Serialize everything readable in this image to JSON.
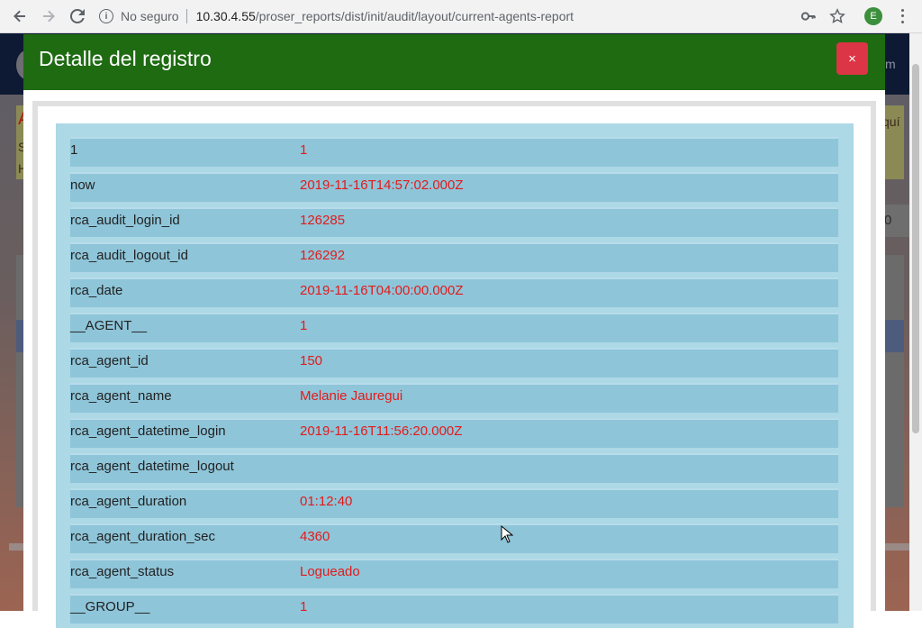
{
  "browser": {
    "not_secure": "No seguro",
    "host": "10.30.4.55",
    "path": "/proser_reports/dist/init/audit/layout/current-agents-report",
    "profile_initial": "E"
  },
  "modal": {
    "title": "Detalle del registro",
    "close_label": "×"
  },
  "record": [
    {
      "key": "1",
      "value": "1"
    },
    {
      "key": "now",
      "value": "2019-11-16T14:57:02.000Z"
    },
    {
      "key": "rca_audit_login_id",
      "value": "126285"
    },
    {
      "key": "rca_audit_logout_id",
      "value": "126292"
    },
    {
      "key": "rca_date",
      "value": "2019-11-16T04:00:00.000Z"
    },
    {
      "key": "__AGENT__",
      "value": "1"
    },
    {
      "key": "rca_agent_id",
      "value": "150"
    },
    {
      "key": "rca_agent_name",
      "value": "Melanie Jauregui"
    },
    {
      "key": "rca_agent_datetime_login",
      "value": "2019-11-16T11:56:20.000Z"
    },
    {
      "key": "rca_agent_datetime_logout",
      "value": ""
    },
    {
      "key": "rca_agent_duration",
      "value": "01:12:40"
    },
    {
      "key": "rca_agent_duration_sec",
      "value": "4360"
    },
    {
      "key": "rca_agent_status",
      "value": "Logueado"
    },
    {
      "key": "__GROUP__",
      "value": "1"
    }
  ],
  "background": {
    "left_letters": [
      "A",
      "S",
      "H"
    ],
    "right_fragment_top": "m",
    "right_fragment_notice": "quí",
    "right_fragment_select": "0"
  }
}
